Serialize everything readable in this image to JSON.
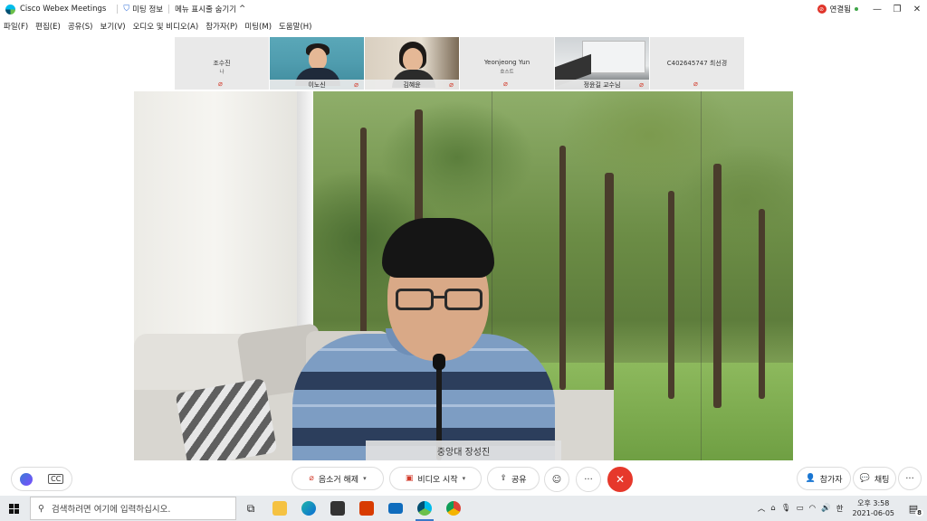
{
  "titlebar": {
    "app_name": "Cisco Webex Meetings",
    "meeting_info": "미팅 정보",
    "menu_toggle": "메뉴 표시줄 숨기기",
    "menu_toggle_chevron": "^",
    "connection_status": "연결됨",
    "minimize": "—",
    "restore": "❐",
    "close": "✕"
  },
  "menubar": {
    "items": [
      "파일(F)",
      "편집(E)",
      "공유(S)",
      "보기(V)",
      "오디오 및 비디오(A)",
      "참가자(P)",
      "미팅(M)",
      "도움말(H)"
    ]
  },
  "participants": [
    {
      "name": "조수진",
      "sub": "나",
      "video": false,
      "muted": true
    },
    {
      "name": "이노신",
      "sub": "",
      "video": true,
      "muted": true
    },
    {
      "name": "김혜윤",
      "sub": "",
      "video": true,
      "muted": true
    },
    {
      "name": "Yeonjeong Yun",
      "sub": "호스트",
      "video": false,
      "muted": true
    },
    {
      "name": "정윤길 교수님",
      "sub": "",
      "video": true,
      "muted": true
    },
    {
      "name": "C402645747 최선경",
      "sub": "",
      "video": false,
      "muted": true
    }
  ],
  "stage": {
    "speaker_label": "중앙대 장성진"
  },
  "controls": {
    "unmute_label": "음소거 해제",
    "start_video_label": "비디오 시작",
    "share_label": "공유",
    "more_label": "···",
    "end_label": "✕",
    "participants_label": "참가자",
    "chat_label": "채팅",
    "cc_label": "CC"
  },
  "taskbar": {
    "search_placeholder": "검색하려면 여기에 입력하십시오.",
    "ime_label": "한",
    "time": "오후 3:58",
    "date": "2021-06-05",
    "notification_count": "8"
  },
  "colors": {
    "end_call": "#e6382b",
    "muted_red": "#d23a2a",
    "connected_green": "#3ea548"
  }
}
